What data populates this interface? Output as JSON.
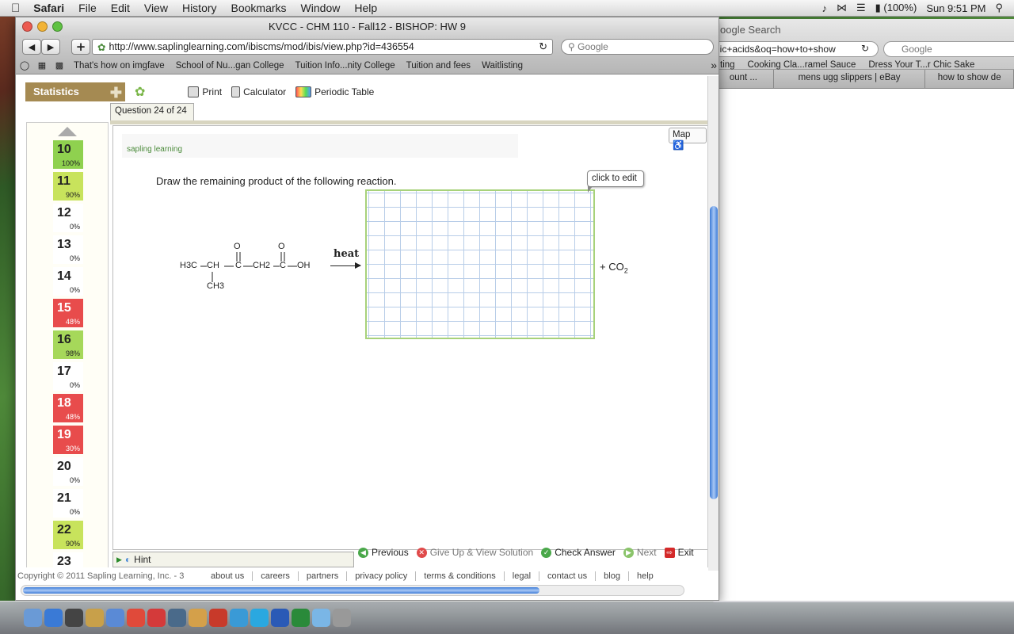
{
  "menubar": {
    "apple": "",
    "app": "Safari",
    "items": [
      "File",
      "Edit",
      "View",
      "History",
      "Bookmarks",
      "Window",
      "Help"
    ],
    "battery": "(100%)",
    "clock": "Sun 9:51 PM"
  },
  "bgwindow": {
    "title": "oogle Search",
    "url": "lic+acids&oq=how+to+show",
    "search_placeholder": "Google",
    "bookmarks": [
      "ting",
      "Cooking Cla...ramel Sauce",
      "Dress Your T...r Chic Sake"
    ],
    "tabs": [
      "ount ...",
      "mens ugg slippers | eBay",
      "how to show de"
    ]
  },
  "window": {
    "title": "KVCC - CHM 110 - Fall12 - BISHOP: HW 9",
    "url": "http://www.saplinglearning.com/ibiscms/mod/ibis/view.php?id=436554",
    "search_placeholder": "Google",
    "bookmarks": [
      "That's how on imgfave",
      "School of Nu...gan College",
      "Tuition Info...nity College",
      "Tuition and fees",
      "Waitlisting"
    ]
  },
  "toolbar": {
    "statistics": "Statistics",
    "print": "Print",
    "calculator": "Calculator",
    "periodic_table": "Periodic Table"
  },
  "question_tab": "Question 24 of 24",
  "questions": [
    {
      "num": "10",
      "pct": "100%",
      "color": "#8fd14f"
    },
    {
      "num": "11",
      "pct": "90%",
      "color": "#c8e35c"
    },
    {
      "num": "12",
      "pct": "0%",
      "color": "#ffffff"
    },
    {
      "num": "13",
      "pct": "0%",
      "color": "#ffffff"
    },
    {
      "num": "14",
      "pct": "0%",
      "color": "#ffffff"
    },
    {
      "num": "15",
      "pct": "48%",
      "color": "#e84c4c"
    },
    {
      "num": "16",
      "pct": "98%",
      "color": "#a6d85a"
    },
    {
      "num": "17",
      "pct": "0%",
      "color": "#ffffff"
    },
    {
      "num": "18",
      "pct": "48%",
      "color": "#e84c4c"
    },
    {
      "num": "19",
      "pct": "30%",
      "color": "#e84c4c"
    },
    {
      "num": "20",
      "pct": "0%",
      "color": "#ffffff"
    },
    {
      "num": "21",
      "pct": "0%",
      "color": "#ffffff"
    },
    {
      "num": "22",
      "pct": "90%",
      "color": "#c8e35c"
    },
    {
      "num": "23",
      "pct": "",
      "color": "#ffffff"
    }
  ],
  "question": {
    "logo": "sapling learning",
    "map": "Map",
    "prompt": "Draw the remaining product of the following reaction.",
    "molecule": {
      "h3c": "H3C",
      "ch": "CH",
      "c1": "C",
      "o1": "O",
      "ch2": "CH2",
      "c2": "C",
      "o2": "O",
      "oh": "OH",
      "ch3": "CH3"
    },
    "arrow_label": "heat",
    "click_to_edit": "click to edit",
    "plus": "+ CO",
    "co2_sub": "2"
  },
  "bottom": {
    "hint": "Hint",
    "previous": "Previous",
    "giveup": "Give Up & View Solution",
    "check": "Check Answer",
    "next": "Next",
    "exit": "Exit"
  },
  "footer": {
    "copyright": "Copyright © 2011 Sapling Learning, Inc. - 3",
    "links": [
      "about us",
      "careers",
      "partners",
      "privacy policy",
      "terms & conditions",
      "legal",
      "contact us",
      "blog",
      "help"
    ]
  },
  "dock_icons": [
    "finder-icon",
    "safari-icon",
    "dashboard-icon",
    "preview-icon",
    "itunes-icon",
    "chrome-icon",
    "calendar-icon",
    "facetime-icon",
    "photo-icon",
    "office-icon",
    "app-store-icon",
    "skype-icon",
    "word-icon",
    "excel-icon",
    "folder-icon",
    "trash-icon"
  ]
}
